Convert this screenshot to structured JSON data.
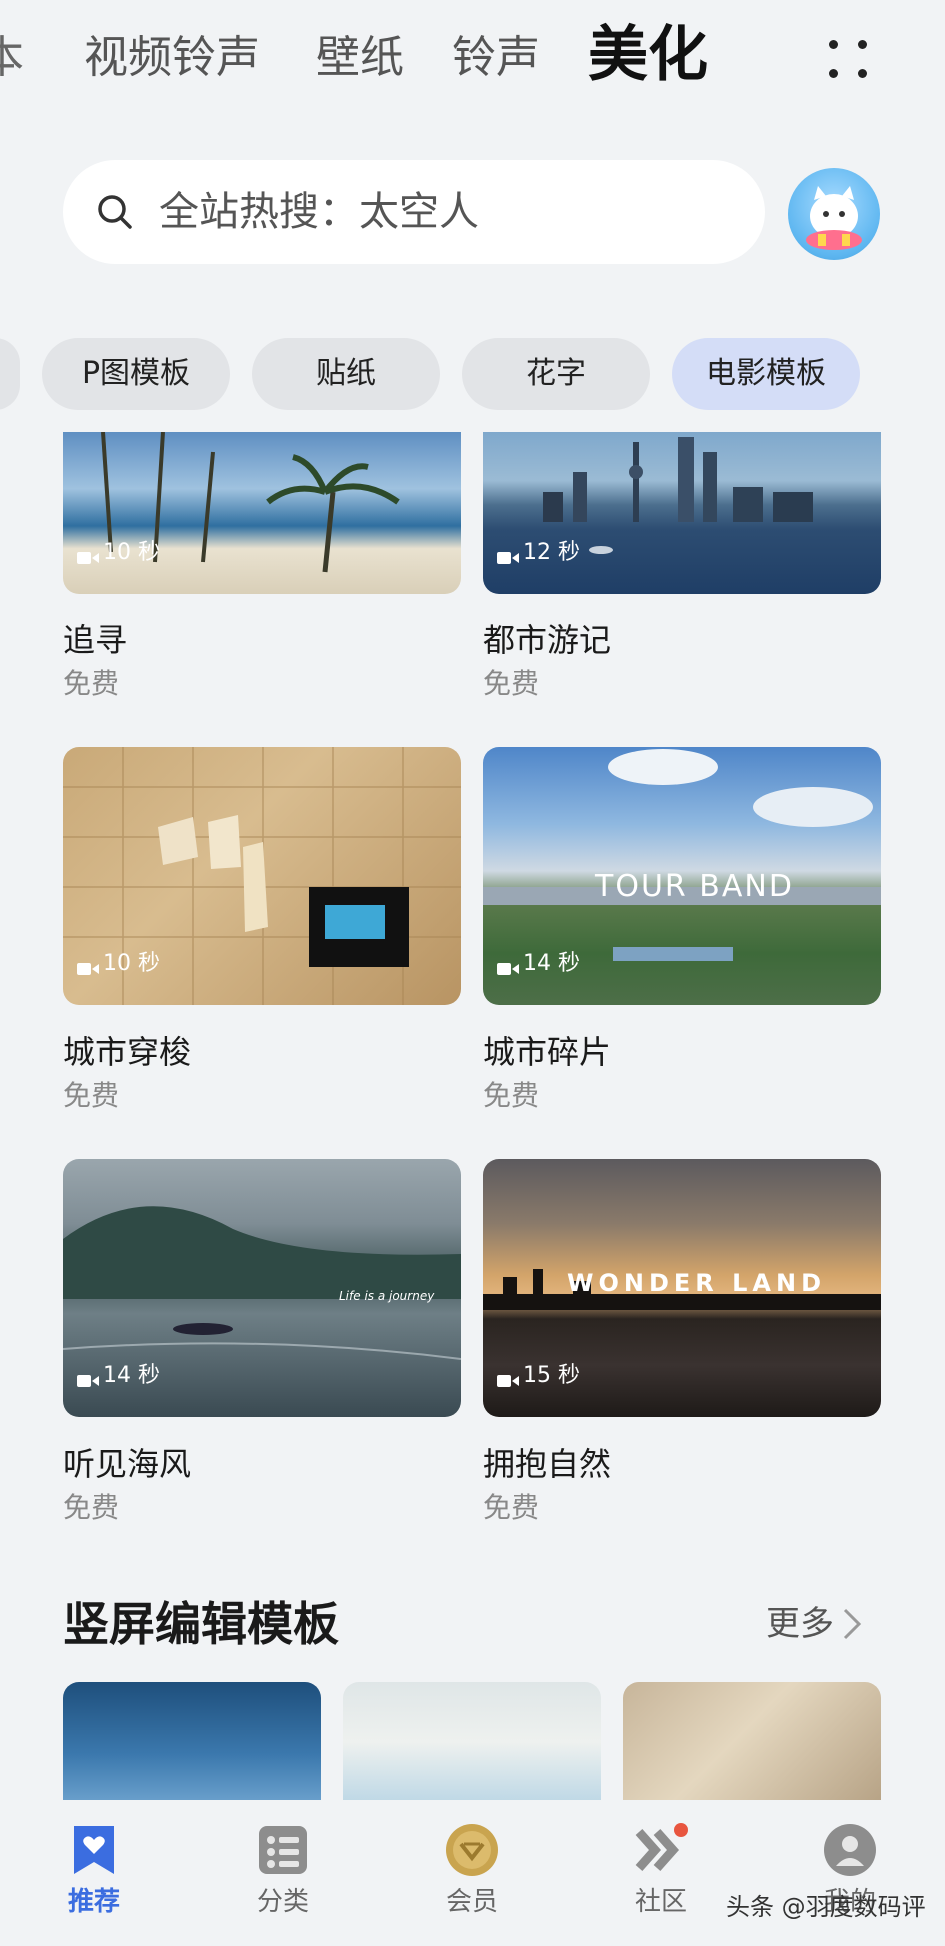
{
  "top_tabs": {
    "partial": "本",
    "items": [
      "视频铃声",
      "壁纸",
      "铃声"
    ],
    "active": "美化"
  },
  "search": {
    "text": "全站热搜：太空人"
  },
  "chips": [
    "P图模板",
    "贴纸",
    "花字",
    "电影模板"
  ],
  "cards": [
    {
      "title": "追寻",
      "price": "免费",
      "duration": "10 秒"
    },
    {
      "title": "都市游记",
      "price": "免费",
      "duration": "12 秒"
    },
    {
      "title": "城市穿梭",
      "price": "免费",
      "duration": "10 秒"
    },
    {
      "title": "城市碎片",
      "price": "免费",
      "duration": "14 秒",
      "overlay": "TOUR  BAND"
    },
    {
      "title": "听见海风",
      "price": "免费",
      "duration": "14 秒",
      "overlay": "Life is a journey"
    },
    {
      "title": "拥抱自然",
      "price": "免费",
      "duration": "15 秒",
      "overlay": "WONDER LAND"
    }
  ],
  "section": {
    "title": "竖屏编辑模板",
    "more": "更多"
  },
  "bottom_nav": [
    {
      "label": "推荐",
      "icon": "heart-bookmark-icon"
    },
    {
      "label": "分类",
      "icon": "category-list-icon"
    },
    {
      "label": "会员",
      "icon": "vip-coin-icon"
    },
    {
      "label": "社区",
      "icon": "community-chevron-icon"
    },
    {
      "label": "我的",
      "icon": "profile-icon"
    }
  ],
  "watermark": "头条 @羽度数码评",
  "colors": {
    "accent": "#3b6de0",
    "active_chip": "#d4ddf7",
    "background": "#f1f3f5"
  }
}
